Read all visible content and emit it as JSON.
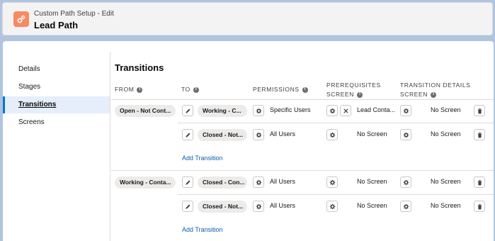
{
  "header": {
    "eyebrow": "Custom Path Setup - Edit",
    "title": "Lead Path",
    "icon": "gears-icon",
    "icon_color": "#f88962"
  },
  "sidebar": {
    "items": [
      {
        "label": "Details"
      },
      {
        "label": "Stages"
      },
      {
        "label": "Transitions",
        "active": true
      },
      {
        "label": "Screens"
      }
    ]
  },
  "transitions": {
    "title": "Transitions",
    "columns": {
      "from": "FROM",
      "to": "TO",
      "permissions": "PERMISSIONS",
      "prereq_1": "PREREQUISITES",
      "prereq_2": "SCREEN",
      "details_1": "TRANSITION DETAILS",
      "details_2": "SCREEN"
    },
    "groups": [
      {
        "from": "Open - Not Cont...",
        "rows": [
          {
            "to": "Working - C...",
            "permission": "Specific Users",
            "prereq": "Lead Conta...",
            "details": "No Screen"
          },
          {
            "to": "Closed - Not...",
            "permission": "All Users",
            "prereq": "No Screen",
            "details": "No Screen"
          }
        ],
        "add_label": "Add Transition"
      },
      {
        "from": "Working - Conta...",
        "rows": [
          {
            "to": "Closed - Con...",
            "permission": "All Users",
            "prereq": "No Screen",
            "details": "No Screen"
          },
          {
            "to": "Closed - Not...",
            "permission": "All Users",
            "prereq": "No Screen",
            "details": "No Screen"
          }
        ],
        "add_label": "Add Transition"
      }
    ]
  },
  "colors": {
    "background": "#b0c4df",
    "accent": "#0176d3",
    "link": "#0b5cab",
    "pill": "#ecebea"
  }
}
